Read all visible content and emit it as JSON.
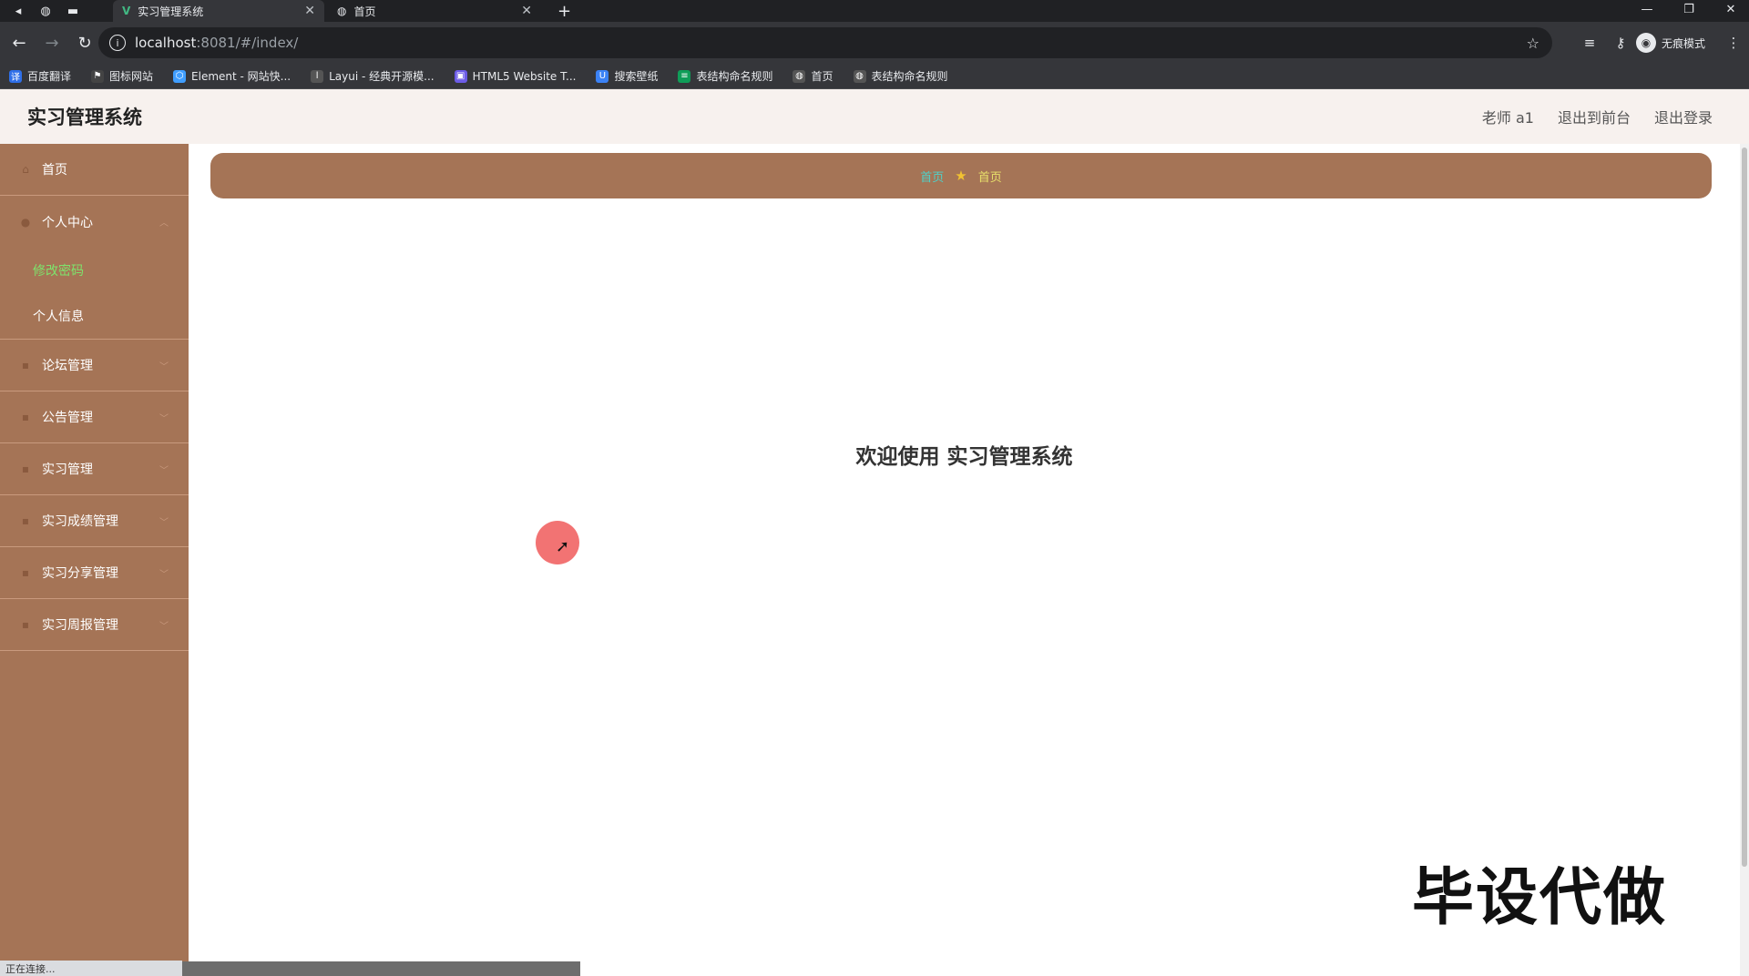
{
  "browser": {
    "tabs": [
      {
        "title": "实习管理系统",
        "active": true
      },
      {
        "title": "首页",
        "active": false
      }
    ],
    "url_host": "localhost",
    "url_path": ":8081/#/index/",
    "incognito_label": "无痕模式",
    "bookmarks": [
      {
        "label": "百度翻译",
        "color": "#2f6fe8"
      },
      {
        "label": "图标网站",
        "color": "#444444"
      },
      {
        "label": "Element - 网站快...",
        "color": "#409eff"
      },
      {
        "label": "Layui - 经典开源模...",
        "color": "#555555"
      },
      {
        "label": "HTML5 Website T...",
        "color": "#6c5ce7"
      },
      {
        "label": "搜索壁纸",
        "color": "#3b82f6"
      },
      {
        "label": "表结构命名规则",
        "color": "#0f9d58"
      },
      {
        "label": "首页",
        "color": "#555555"
      },
      {
        "label": "表结构命名规则",
        "color": "#555555"
      }
    ],
    "status_text": "正在连接..."
  },
  "header": {
    "title": "实习管理系统",
    "user": "老师 a1",
    "to_front": "退出到前台",
    "logout": "退出登录"
  },
  "sidebar": {
    "items": [
      {
        "label": "首页",
        "icon": "home-icon"
      },
      {
        "label": "个人中心",
        "icon": "user-icon",
        "children": [
          {
            "label": "修改密码",
            "active": true
          },
          {
            "label": "个人信息",
            "active": false
          }
        ]
      },
      {
        "label": "论坛管理",
        "icon": "menu-icon"
      },
      {
        "label": "公告管理",
        "icon": "menu-icon"
      },
      {
        "label": "实习管理",
        "icon": "menu-icon"
      },
      {
        "label": "实习成绩管理",
        "icon": "menu-icon"
      },
      {
        "label": "实习分享管理",
        "icon": "menu-icon"
      },
      {
        "label": "实习周报管理",
        "icon": "menu-icon"
      }
    ]
  },
  "breadcrumb": {
    "first": "首页",
    "current": "首页"
  },
  "main": {
    "welcome": "欢迎使用 实习管理系统"
  },
  "watermark": "毕设代做",
  "colors": {
    "sidebar_bg": "#a57456",
    "header_bg": "#f7f1ee",
    "active_sub": "#7ee36c",
    "breadcrumb_link": "#4fd0c8"
  }
}
